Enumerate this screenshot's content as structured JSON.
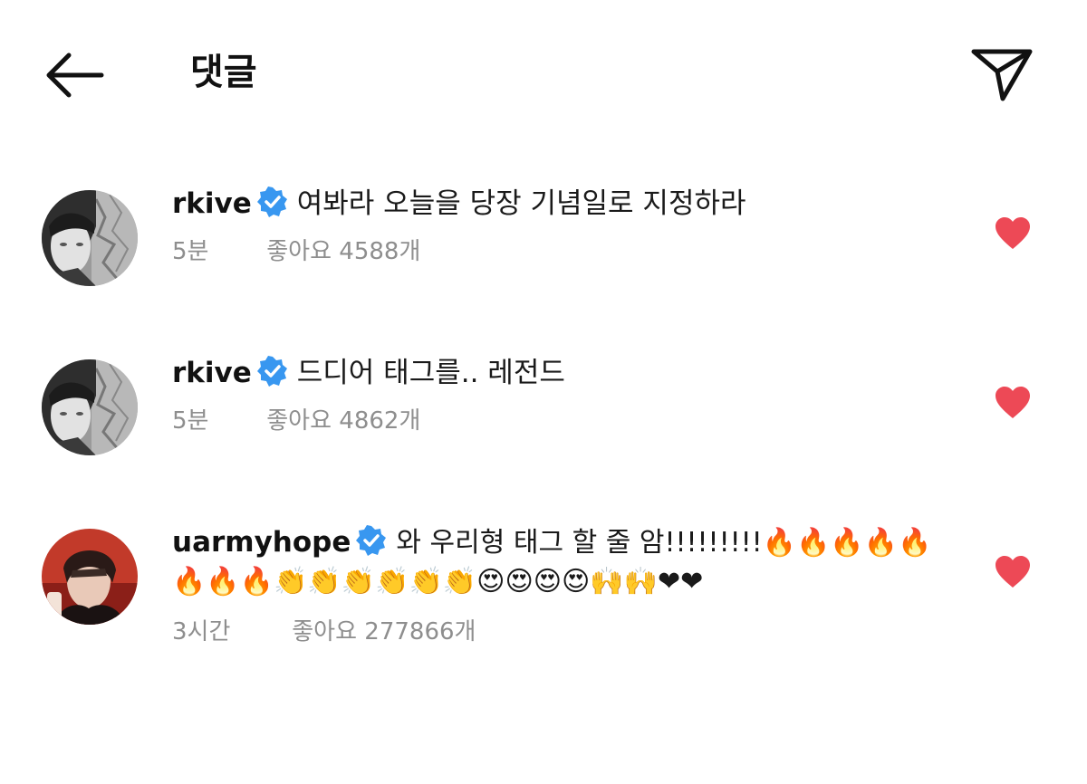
{
  "header": {
    "title": "댓글",
    "back_icon": "arrow-left-icon",
    "send_icon": "paper-plane-icon"
  },
  "comments": [
    {
      "username": "rkive",
      "verified": true,
      "text": "여봐라 오늘을 당장 기념일로 지정하라",
      "time": "5분",
      "likes": "좋아요 4588개",
      "liked": true
    },
    {
      "username": "rkive",
      "verified": true,
      "text": "드디어 태그를.. 레전드",
      "time": "5분",
      "likes": "좋아요 4862개",
      "liked": true
    },
    {
      "username": "uarmyhope",
      "verified": true,
      "text": "와 우리형 태그 할 줄 암!!!!!!!!!🔥🔥🔥🔥🔥🔥🔥🔥👏👏👏👏👏👏😍😍😍😍🙌🙌❤❤",
      "time": "3시간",
      "likes": "좋아요 277866개",
      "liked": true
    }
  ],
  "colors": {
    "heart": "#ed4956",
    "verified": "#3897f0",
    "meta_text": "#8e8e8e"
  }
}
